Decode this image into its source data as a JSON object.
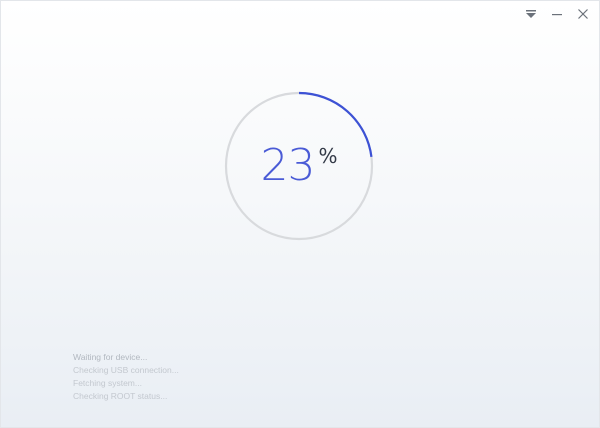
{
  "window": {
    "controls": [
      {
        "icon": "dropdown-arrow-icon"
      },
      {
        "icon": "minimize-icon"
      },
      {
        "icon": "close-icon"
      }
    ]
  },
  "progress": {
    "value": 23,
    "fraction": 0.23,
    "unit": "%",
    "track_color": "#d8dadd",
    "fill_color": "#3d52d5"
  },
  "status": {
    "lines": [
      "Waiting for device...",
      "Checking USB connection...",
      "Fetching system...",
      "Checking ROOT status..."
    ]
  }
}
